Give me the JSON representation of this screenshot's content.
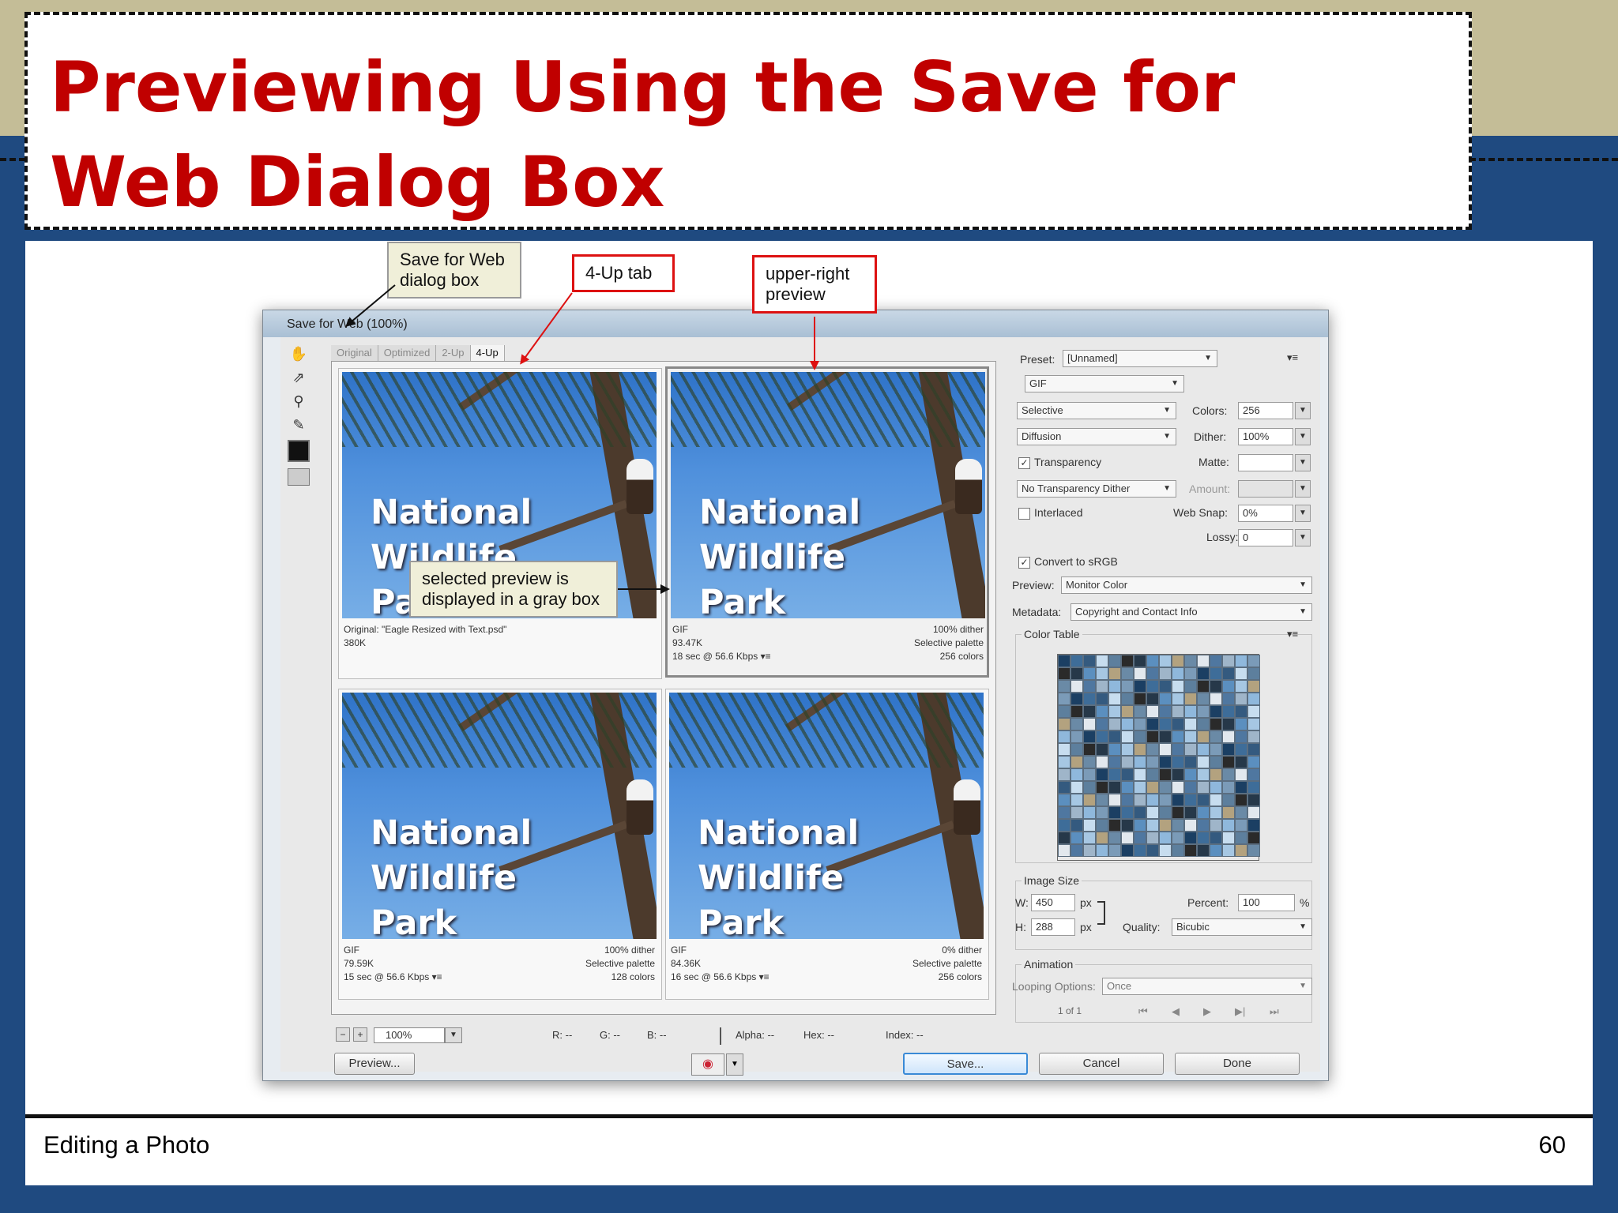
{
  "slide": {
    "title": "Previewing Using the Save for\nWeb Dialog Box",
    "footer_left": "Editing a Photo",
    "page_number": "60"
  },
  "dialog": {
    "window_title": "Save for Web (100%)",
    "tabs": [
      {
        "label": "Original"
      },
      {
        "label": "Optimized"
      },
      {
        "label": "2-Up"
      },
      {
        "label": "4-Up"
      }
    ],
    "photo_text": "National\nWildlife\nPark",
    "panes": [
      {
        "info_left": [
          "Original: \"Eagle Resized with Text.psd\"",
          "380K"
        ],
        "info_right": [
          "",
          "",
          ""
        ]
      },
      {
        "info_left": [
          "GIF",
          "93.47K",
          "18 sec @ 56.6 Kbps  ▾≡"
        ],
        "info_right": [
          "100% dither",
          "Selective palette",
          "256 colors"
        ]
      },
      {
        "info_left": [
          "GIF",
          "79.59K",
          "15 sec @ 56.6 Kbps  ▾≡"
        ],
        "info_right": [
          "100% dither",
          "Selective palette",
          "128 colors"
        ]
      },
      {
        "info_left": [
          "GIF",
          "84.36K",
          "16 sec @ 56.6 Kbps  ▾≡"
        ],
        "info_right": [
          "0% dither",
          "Selective palette",
          "256 colors"
        ]
      }
    ],
    "zoom": "100%",
    "readouts": {
      "r": "R: --",
      "g": "G: --",
      "b": "B: --",
      "alpha": "Alpha: --",
      "hex": "Hex: --",
      "index": "Index: --"
    },
    "buttons": {
      "preview": "Preview...",
      "save": "Save...",
      "cancel": "Cancel",
      "done": "Done"
    },
    "settings": {
      "preset_label": "Preset:",
      "preset_value": "[Unnamed]",
      "format": "GIF",
      "reduction": "Selective",
      "colors_label": "Colors:",
      "colors_value": "256",
      "dither_algo": "Diffusion",
      "dither_label": "Dither:",
      "dither_value": "100%",
      "transparency_label": "Transparency",
      "matte_label": "Matte:",
      "matte_value": "",
      "transparency_dither": "No Transparency Dither",
      "amount_label": "Amount:",
      "amount_value": "",
      "interlaced_label": "Interlaced",
      "web_snap_label": "Web Snap:",
      "web_snap_value": "0%",
      "lossy_label": "Lossy:",
      "lossy_value": "0",
      "convert_label": "Convert to sRGB",
      "preview_label": "Preview:",
      "preview_value": "Monitor Color",
      "metadata_label": "Metadata:",
      "metadata_value": "Copyright and Contact Info",
      "color_table_label": "Color Table",
      "color_count": "256",
      "image_size_label": "Image Size",
      "w_label": "W:",
      "w_value": "450",
      "h_label": "H:",
      "h_value": "288",
      "px": "px",
      "percent_label": "Percent:",
      "percent_value": "100",
      "percent_sign": "%",
      "quality_label": "Quality:",
      "quality_value": "Bicubic",
      "animation_label": "Animation",
      "looping_label": "Looping Options:",
      "looping_value": "Once",
      "frame_counter": "1 of 1"
    },
    "palette_colors": [
      "#1b3f63",
      "#5b8fbf",
      "#8fb8dc",
      "#2a2a2a",
      "#4f77a0",
      "#c7ddef",
      "#6a8aa6",
      "#3e6d99",
      "#a6c7e3",
      "#7b9bb8",
      "#263849",
      "#9fb5c9",
      "#5d7f9d",
      "#e2e8ee",
      "#345a7f",
      "#b3a27f"
    ]
  },
  "callouts": {
    "dialog_box": "Save for Web\ndialog box",
    "four_up_tab": "4-Up tab",
    "upper_right": "upper-right\npreview",
    "selected_preview": "selected preview is\ndisplayed in a gray box"
  },
  "colors": {
    "title": "#c00000",
    "slide_bg": "#1f4a80",
    "band": "#c4bd97",
    "callout_red": "#dd1111"
  }
}
